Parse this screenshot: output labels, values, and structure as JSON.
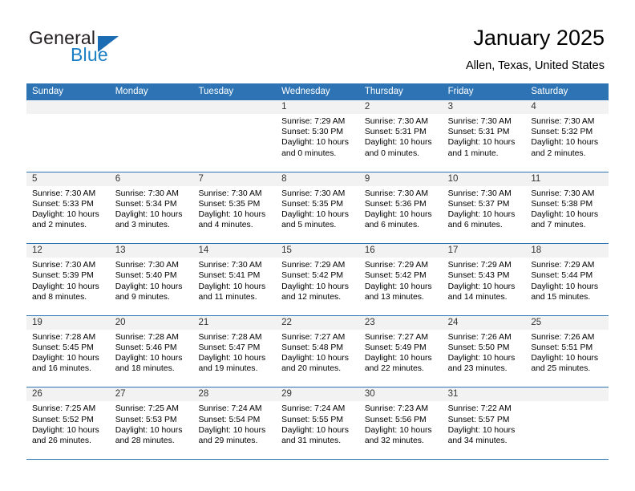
{
  "brand": {
    "name_top": "General",
    "name_bottom": "Blue",
    "accent_color": "#1b7fc4",
    "triangle_color": "#1b6cb3"
  },
  "header": {
    "title": "January 2025",
    "location": "Allen, Texas, United States",
    "header_bg_color": "#2E74B5",
    "day_strip_color": "#F2F2F2"
  },
  "weekdays": [
    "Sunday",
    "Monday",
    "Tuesday",
    "Wednesday",
    "Thursday",
    "Friday",
    "Saturday"
  ],
  "weeks": [
    [
      {
        "day": "",
        "sunrise": "",
        "sunset": "",
        "daylight_line1": "",
        "daylight_line2": "",
        "empty": true
      },
      {
        "day": "",
        "sunrise": "",
        "sunset": "",
        "daylight_line1": "",
        "daylight_line2": "",
        "empty": true
      },
      {
        "day": "",
        "sunrise": "",
        "sunset": "",
        "daylight_line1": "",
        "daylight_line2": "",
        "empty": true
      },
      {
        "day": "1",
        "sunrise": "Sunrise: 7:29 AM",
        "sunset": "Sunset: 5:30 PM",
        "daylight_line1": "Daylight: 10 hours",
        "daylight_line2": "and 0 minutes."
      },
      {
        "day": "2",
        "sunrise": "Sunrise: 7:30 AM",
        "sunset": "Sunset: 5:31 PM",
        "daylight_line1": "Daylight: 10 hours",
        "daylight_line2": "and 0 minutes."
      },
      {
        "day": "3",
        "sunrise": "Sunrise: 7:30 AM",
        "sunset": "Sunset: 5:31 PM",
        "daylight_line1": "Daylight: 10 hours",
        "daylight_line2": "and 1 minute."
      },
      {
        "day": "4",
        "sunrise": "Sunrise: 7:30 AM",
        "sunset": "Sunset: 5:32 PM",
        "daylight_line1": "Daylight: 10 hours",
        "daylight_line2": "and 2 minutes."
      }
    ],
    [
      {
        "day": "5",
        "sunrise": "Sunrise: 7:30 AM",
        "sunset": "Sunset: 5:33 PM",
        "daylight_line1": "Daylight: 10 hours",
        "daylight_line2": "and 2 minutes."
      },
      {
        "day": "6",
        "sunrise": "Sunrise: 7:30 AM",
        "sunset": "Sunset: 5:34 PM",
        "daylight_line1": "Daylight: 10 hours",
        "daylight_line2": "and 3 minutes."
      },
      {
        "day": "7",
        "sunrise": "Sunrise: 7:30 AM",
        "sunset": "Sunset: 5:35 PM",
        "daylight_line1": "Daylight: 10 hours",
        "daylight_line2": "and 4 minutes."
      },
      {
        "day": "8",
        "sunrise": "Sunrise: 7:30 AM",
        "sunset": "Sunset: 5:35 PM",
        "daylight_line1": "Daylight: 10 hours",
        "daylight_line2": "and 5 minutes."
      },
      {
        "day": "9",
        "sunrise": "Sunrise: 7:30 AM",
        "sunset": "Sunset: 5:36 PM",
        "daylight_line1": "Daylight: 10 hours",
        "daylight_line2": "and 6 minutes."
      },
      {
        "day": "10",
        "sunrise": "Sunrise: 7:30 AM",
        "sunset": "Sunset: 5:37 PM",
        "daylight_line1": "Daylight: 10 hours",
        "daylight_line2": "and 6 minutes."
      },
      {
        "day": "11",
        "sunrise": "Sunrise: 7:30 AM",
        "sunset": "Sunset: 5:38 PM",
        "daylight_line1": "Daylight: 10 hours",
        "daylight_line2": "and 7 minutes."
      }
    ],
    [
      {
        "day": "12",
        "sunrise": "Sunrise: 7:30 AM",
        "sunset": "Sunset: 5:39 PM",
        "daylight_line1": "Daylight: 10 hours",
        "daylight_line2": "and 8 minutes."
      },
      {
        "day": "13",
        "sunrise": "Sunrise: 7:30 AM",
        "sunset": "Sunset: 5:40 PM",
        "daylight_line1": "Daylight: 10 hours",
        "daylight_line2": "and 9 minutes."
      },
      {
        "day": "14",
        "sunrise": "Sunrise: 7:30 AM",
        "sunset": "Sunset: 5:41 PM",
        "daylight_line1": "Daylight: 10 hours",
        "daylight_line2": "and 11 minutes."
      },
      {
        "day": "15",
        "sunrise": "Sunrise: 7:29 AM",
        "sunset": "Sunset: 5:42 PM",
        "daylight_line1": "Daylight: 10 hours",
        "daylight_line2": "and 12 minutes."
      },
      {
        "day": "16",
        "sunrise": "Sunrise: 7:29 AM",
        "sunset": "Sunset: 5:42 PM",
        "daylight_line1": "Daylight: 10 hours",
        "daylight_line2": "and 13 minutes."
      },
      {
        "day": "17",
        "sunrise": "Sunrise: 7:29 AM",
        "sunset": "Sunset: 5:43 PM",
        "daylight_line1": "Daylight: 10 hours",
        "daylight_line2": "and 14 minutes."
      },
      {
        "day": "18",
        "sunrise": "Sunrise: 7:29 AM",
        "sunset": "Sunset: 5:44 PM",
        "daylight_line1": "Daylight: 10 hours",
        "daylight_line2": "and 15 minutes."
      }
    ],
    [
      {
        "day": "19",
        "sunrise": "Sunrise: 7:28 AM",
        "sunset": "Sunset: 5:45 PM",
        "daylight_line1": "Daylight: 10 hours",
        "daylight_line2": "and 16 minutes."
      },
      {
        "day": "20",
        "sunrise": "Sunrise: 7:28 AM",
        "sunset": "Sunset: 5:46 PM",
        "daylight_line1": "Daylight: 10 hours",
        "daylight_line2": "and 18 minutes."
      },
      {
        "day": "21",
        "sunrise": "Sunrise: 7:28 AM",
        "sunset": "Sunset: 5:47 PM",
        "daylight_line1": "Daylight: 10 hours",
        "daylight_line2": "and 19 minutes."
      },
      {
        "day": "22",
        "sunrise": "Sunrise: 7:27 AM",
        "sunset": "Sunset: 5:48 PM",
        "daylight_line1": "Daylight: 10 hours",
        "daylight_line2": "and 20 minutes."
      },
      {
        "day": "23",
        "sunrise": "Sunrise: 7:27 AM",
        "sunset": "Sunset: 5:49 PM",
        "daylight_line1": "Daylight: 10 hours",
        "daylight_line2": "and 22 minutes."
      },
      {
        "day": "24",
        "sunrise": "Sunrise: 7:26 AM",
        "sunset": "Sunset: 5:50 PM",
        "daylight_line1": "Daylight: 10 hours",
        "daylight_line2": "and 23 minutes."
      },
      {
        "day": "25",
        "sunrise": "Sunrise: 7:26 AM",
        "sunset": "Sunset: 5:51 PM",
        "daylight_line1": "Daylight: 10 hours",
        "daylight_line2": "and 25 minutes."
      }
    ],
    [
      {
        "day": "26",
        "sunrise": "Sunrise: 7:25 AM",
        "sunset": "Sunset: 5:52 PM",
        "daylight_line1": "Daylight: 10 hours",
        "daylight_line2": "and 26 minutes."
      },
      {
        "day": "27",
        "sunrise": "Sunrise: 7:25 AM",
        "sunset": "Sunset: 5:53 PM",
        "daylight_line1": "Daylight: 10 hours",
        "daylight_line2": "and 28 minutes."
      },
      {
        "day": "28",
        "sunrise": "Sunrise: 7:24 AM",
        "sunset": "Sunset: 5:54 PM",
        "daylight_line1": "Daylight: 10 hours",
        "daylight_line2": "and 29 minutes."
      },
      {
        "day": "29",
        "sunrise": "Sunrise: 7:24 AM",
        "sunset": "Sunset: 5:55 PM",
        "daylight_line1": "Daylight: 10 hours",
        "daylight_line2": "and 31 minutes."
      },
      {
        "day": "30",
        "sunrise": "Sunrise: 7:23 AM",
        "sunset": "Sunset: 5:56 PM",
        "daylight_line1": "Daylight: 10 hours",
        "daylight_line2": "and 32 minutes."
      },
      {
        "day": "31",
        "sunrise": "Sunrise: 7:22 AM",
        "sunset": "Sunset: 5:57 PM",
        "daylight_line1": "Daylight: 10 hours",
        "daylight_line2": "and 34 minutes."
      },
      {
        "day": "",
        "sunrise": "",
        "sunset": "",
        "daylight_line1": "",
        "daylight_line2": "",
        "empty": true
      }
    ]
  ]
}
